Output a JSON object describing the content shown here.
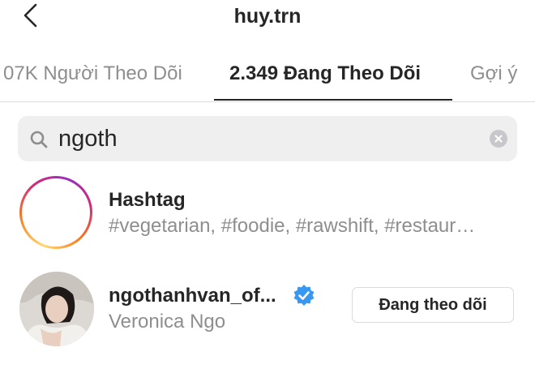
{
  "header": {
    "title": "huy.trn",
    "back_icon": "chevron-left-icon"
  },
  "tabs": [
    {
      "label": "07K Người Theo Dõi",
      "active": false
    },
    {
      "label": "2.349 Đang Theo Dõi",
      "active": true
    },
    {
      "label": "Gợi ý",
      "active": false
    }
  ],
  "search": {
    "value": "ngoth",
    "icon": "search-icon",
    "clear_icon": "clear-icon"
  },
  "results": [
    {
      "type": "hashtag",
      "title": "Hashtag",
      "subtitle": "#vegetarian, #foodie, #rawshift, #restaur…",
      "icon": "hashtag-icon"
    },
    {
      "type": "user",
      "username": "ngothanhvan_of...",
      "full_name": "Veronica Ngo",
      "verified": true,
      "button_label": "Đang theo dõi"
    }
  ],
  "colors": {
    "verified_blue": "#3897f0",
    "muted_text": "#8e8e8e",
    "search_bg": "#efeff0"
  }
}
